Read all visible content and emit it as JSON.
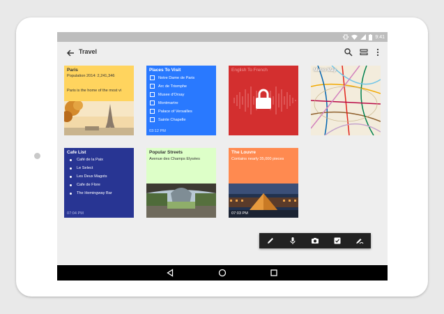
{
  "status": {
    "time": "9:41"
  },
  "toolbar": {
    "title": "Travel",
    "back_icon": "arrow-back-icon",
    "search_icon": "search-icon",
    "view_icon": "view-list-icon",
    "menu_icon": "more-vert-icon"
  },
  "notes": {
    "paris": {
      "title": "Paris",
      "line1": "Population 2014: 2,241,346",
      "line2": "Paris is the home of the most vi",
      "color": "#ffd45e"
    },
    "places": {
      "title": "Places To Visit",
      "items": [
        "Notre Dame de Paris",
        "Arc de Triomphe",
        "Musee d'Orsay",
        "Montmartre",
        "Palace of Versailles",
        "Sainte Chapelle"
      ],
      "time": "03:12 PM",
      "color": "#2979ff"
    },
    "english": {
      "title": "English To French",
      "color": "#d32f2f",
      "icon": "lock-icon"
    },
    "metro": {
      "title": "Metro Map"
    },
    "cafe": {
      "title": "Cafe List",
      "items": [
        "Café de la Paix",
        "Le Select",
        "Les Deux Magots",
        "Cafe de Flore",
        "The Hemingway Bar"
      ],
      "time": "07:04 PM",
      "color": "#283593"
    },
    "streets": {
      "title": "Popular Streets",
      "line1": "Avenue des Champs Elysées",
      "color": "#ddffc8"
    },
    "louvre": {
      "title": "The Louvre",
      "line1": "Contains nearly 35,000 pieces",
      "time": "07:03 PM",
      "color": "#ff8a50"
    }
  },
  "fab": {
    "icons": [
      "pencil-icon",
      "mic-icon",
      "camera-icon",
      "checkbox-icon",
      "draw-icon"
    ]
  },
  "nav": {
    "icons": [
      "back-triangle-icon",
      "home-circle-icon",
      "recents-square-icon"
    ]
  }
}
